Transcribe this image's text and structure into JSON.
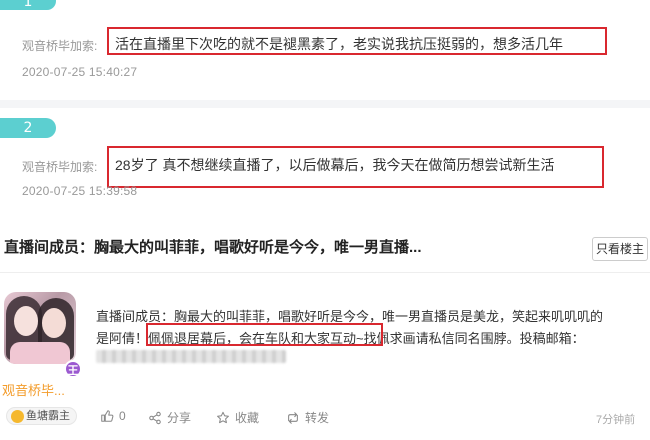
{
  "comments": [
    {
      "index": "1",
      "author": "观音桥毕加索:",
      "text": "活在直播里下次吃的就不是褪黑素了，老实说我抗压挺弱的，想多活几年",
      "time": "2020-07-25 15:40:27"
    },
    {
      "index": "2",
      "author": "观音桥毕加索:",
      "text": "28岁了 真不想继续直播了，以后做幕后，我今天在做简历想尝试新生活",
      "time": "2020-07-25 15:39:58"
    }
  ],
  "post": {
    "title": "直播间成员：胸最大的叫菲菲，唱歌好听是今今，唯一男直播...",
    "only_author_button": "只看楼主",
    "body_line1": "直播间成员：胸最大的叫菲菲，唱歌好听是今今，唯一男直播员是美龙，笑起来叽叽叽的",
    "body_line2_prefix": "是阿倩！",
    "body_line2_highlight": "佩佩退居幕后，会在车队和大家互动",
    "body_line2_suffix": "~找佩求画请私信同名围脖。投稿邮箱：",
    "author_nick": "观音桥毕...",
    "crown_badge": "王",
    "level_tag": "鱼塘霸主",
    "likes": "0",
    "share": "分享",
    "favorite": "收藏",
    "repost": "转发",
    "time_ago": "7分钟前"
  },
  "colors": {
    "badge_teal": "#5ccfd0",
    "highlight_red": "#d9282f",
    "nick_orange": "#f39c2b"
  },
  "icons": [
    "thumb-up-icon",
    "share-icon",
    "star-icon",
    "repost-icon",
    "crown-icon"
  ]
}
